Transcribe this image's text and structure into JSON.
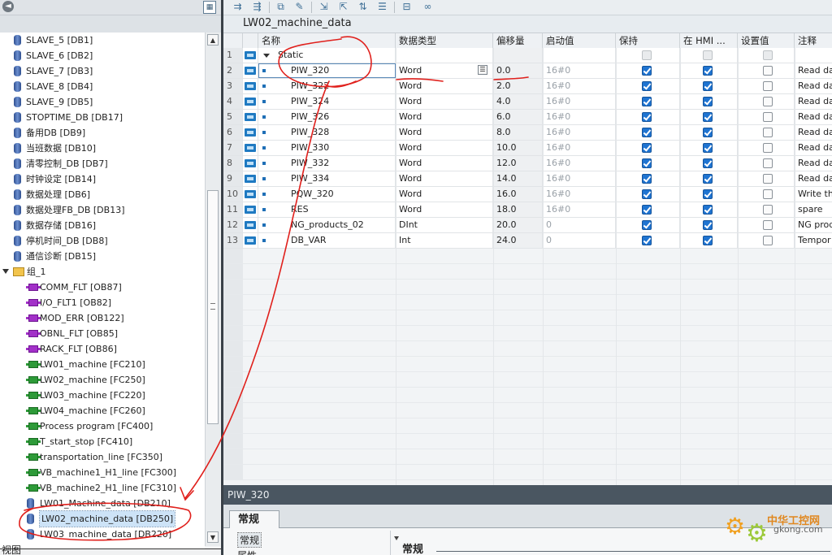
{
  "project_tree": {
    "items": [
      {
        "label": "SLAVE_5 [DB1]",
        "icon": "db-icon",
        "indent": 1
      },
      {
        "label": "SLAVE_6 [DB2]",
        "icon": "db-icon",
        "indent": 1
      },
      {
        "label": "SLAVE_7 [DB3]",
        "icon": "db-icon",
        "indent": 1
      },
      {
        "label": "SLAVE_8 [DB4]",
        "icon": "db-icon",
        "indent": 1
      },
      {
        "label": "SLAVE_9 [DB5]",
        "icon": "db-icon",
        "indent": 1
      },
      {
        "label": "STOPTIME_DB [DB17]",
        "icon": "db-icon",
        "indent": 1
      },
      {
        "label": "备用DB [DB9]",
        "icon": "db-icon",
        "indent": 1
      },
      {
        "label": "当班数据 [DB10]",
        "icon": "db-icon",
        "indent": 1
      },
      {
        "label": "清零控制_DB [DB7]",
        "icon": "db-icon",
        "indent": 1
      },
      {
        "label": "时钟设定 [DB14]",
        "icon": "db-icon",
        "indent": 1
      },
      {
        "label": "数据处理 [DB6]",
        "icon": "db-icon",
        "indent": 1
      },
      {
        "label": "数据处理FB_DB [DB13]",
        "icon": "db-icon",
        "indent": 1
      },
      {
        "label": "数据存储 [DB16]",
        "icon": "db-icon",
        "indent": 1
      },
      {
        "label": "停机时间_DB [DB8]",
        "icon": "db-icon",
        "indent": 1
      },
      {
        "label": "通信诊断 [DB15]",
        "icon": "db-icon",
        "indent": 1
      },
      {
        "label": "组_1",
        "icon": "folder-icon",
        "indent": 0
      },
      {
        "label": "COMM_FLT [OB87]",
        "icon": "ob-icon",
        "indent": 2
      },
      {
        "label": "I/O_FLT1 [OB82]",
        "icon": "ob-icon",
        "indent": 2
      },
      {
        "label": "MOD_ERR [OB122]",
        "icon": "ob-icon",
        "indent": 2
      },
      {
        "label": "OBNL_FLT [OB85]",
        "icon": "ob-icon",
        "indent": 2
      },
      {
        "label": "RACK_FLT [OB86]",
        "icon": "ob-icon",
        "indent": 2
      },
      {
        "label": "LW01_machine [FC210]",
        "icon": "fc-icon",
        "indent": 2
      },
      {
        "label": "LW02_machine [FC250]",
        "icon": "fc-icon",
        "indent": 2
      },
      {
        "label": "LW03_machine [FC220]",
        "icon": "fc-icon",
        "indent": 2
      },
      {
        "label": "LW04_machine [FC260]",
        "icon": "fc-icon",
        "indent": 2
      },
      {
        "label": "Process program [FC400]",
        "icon": "fc-icon",
        "indent": 2
      },
      {
        "label": "T_start_stop [FC410]",
        "icon": "fc-icon",
        "indent": 2
      },
      {
        "label": "transportation_line [FC350]",
        "icon": "fc-icon",
        "indent": 2
      },
      {
        "label": "VB_machine1_H1_line [FC300]",
        "icon": "fc-icon",
        "indent": 2
      },
      {
        "label": "VB_machine2_H1_line [FC310]",
        "icon": "fc-icon",
        "indent": 2
      },
      {
        "label": "LW01_Machine_data [DB210]",
        "icon": "db-icon",
        "indent": 2
      },
      {
        "label": "LW02_machine_data [DB250]",
        "icon": "db-icon",
        "indent": 2,
        "selected": true
      },
      {
        "label": "LW03_machine_data [DB220]",
        "icon": "db-icon",
        "indent": 2
      }
    ],
    "bottom_label": "视图"
  },
  "editor": {
    "db_title": "LW02_machine_data",
    "columns": [
      "名称",
      "数据类型",
      "偏移量",
      "启动值",
      "保持",
      "在 HMI ...",
      "设置值",
      "注释"
    ],
    "rows": [
      {
        "num": "1",
        "name": "Static",
        "type": "",
        "offset": "",
        "start": "",
        "keep": false,
        "hmi": false,
        "set": false,
        "comment": "",
        "is_static": true
      },
      {
        "num": "2",
        "name": "PIW_320",
        "type": "Word",
        "offset": "0.0",
        "start": "16#0",
        "keep": true,
        "hmi": true,
        "set": false,
        "comment": "Read da",
        "selected": true
      },
      {
        "num": "3",
        "name": "PIW_322",
        "type": "Word",
        "offset": "2.0",
        "start": "16#0",
        "keep": true,
        "hmi": true,
        "set": false,
        "comment": "Read da"
      },
      {
        "num": "4",
        "name": "PIW_324",
        "type": "Word",
        "offset": "4.0",
        "start": "16#0",
        "keep": true,
        "hmi": true,
        "set": false,
        "comment": "Read da"
      },
      {
        "num": "5",
        "name": "PIW_326",
        "type": "Word",
        "offset": "6.0",
        "start": "16#0",
        "keep": true,
        "hmi": true,
        "set": false,
        "comment": "Read da"
      },
      {
        "num": "6",
        "name": "PIW_328",
        "type": "Word",
        "offset": "8.0",
        "start": "16#0",
        "keep": true,
        "hmi": true,
        "set": false,
        "comment": "Read da"
      },
      {
        "num": "7",
        "name": "PIW_330",
        "type": "Word",
        "offset": "10.0",
        "start": "16#0",
        "keep": true,
        "hmi": true,
        "set": false,
        "comment": "Read da"
      },
      {
        "num": "8",
        "name": "PIW_332",
        "type": "Word",
        "offset": "12.0",
        "start": "16#0",
        "keep": true,
        "hmi": true,
        "set": false,
        "comment": "Read da"
      },
      {
        "num": "9",
        "name": "PIW_334",
        "type": "Word",
        "offset": "14.0",
        "start": "16#0",
        "keep": true,
        "hmi": true,
        "set": false,
        "comment": "Read da"
      },
      {
        "num": "10",
        "name": "PQW_320",
        "type": "Word",
        "offset": "16.0",
        "start": "16#0",
        "keep": true,
        "hmi": true,
        "set": false,
        "comment": "Write the"
      },
      {
        "num": "11",
        "name": "RES",
        "type": "Word",
        "offset": "18.0",
        "start": "16#0",
        "keep": true,
        "hmi": true,
        "set": false,
        "comment": "spare"
      },
      {
        "num": "12",
        "name": "NG_products_02",
        "type": "DInt",
        "offset": "20.0",
        "start": "0",
        "keep": true,
        "hmi": true,
        "set": false,
        "comment": "NG prod"
      },
      {
        "num": "13",
        "name": "DB_VAR",
        "type": "Int",
        "offset": "24.0",
        "start": "0",
        "keep": true,
        "hmi": true,
        "set": false,
        "comment": "Tempor"
      }
    ]
  },
  "properties": {
    "title": "PIW_320",
    "tab": "常规",
    "nav_items": [
      "常规",
      "属性"
    ],
    "section": "常规"
  },
  "watermark": {
    "name": "中华工控网",
    "domain": "gkong.com"
  },
  "colors": {
    "accent": "#1f74d1",
    "annotation": "#e0201c",
    "panel_dark": "#4a5661"
  }
}
